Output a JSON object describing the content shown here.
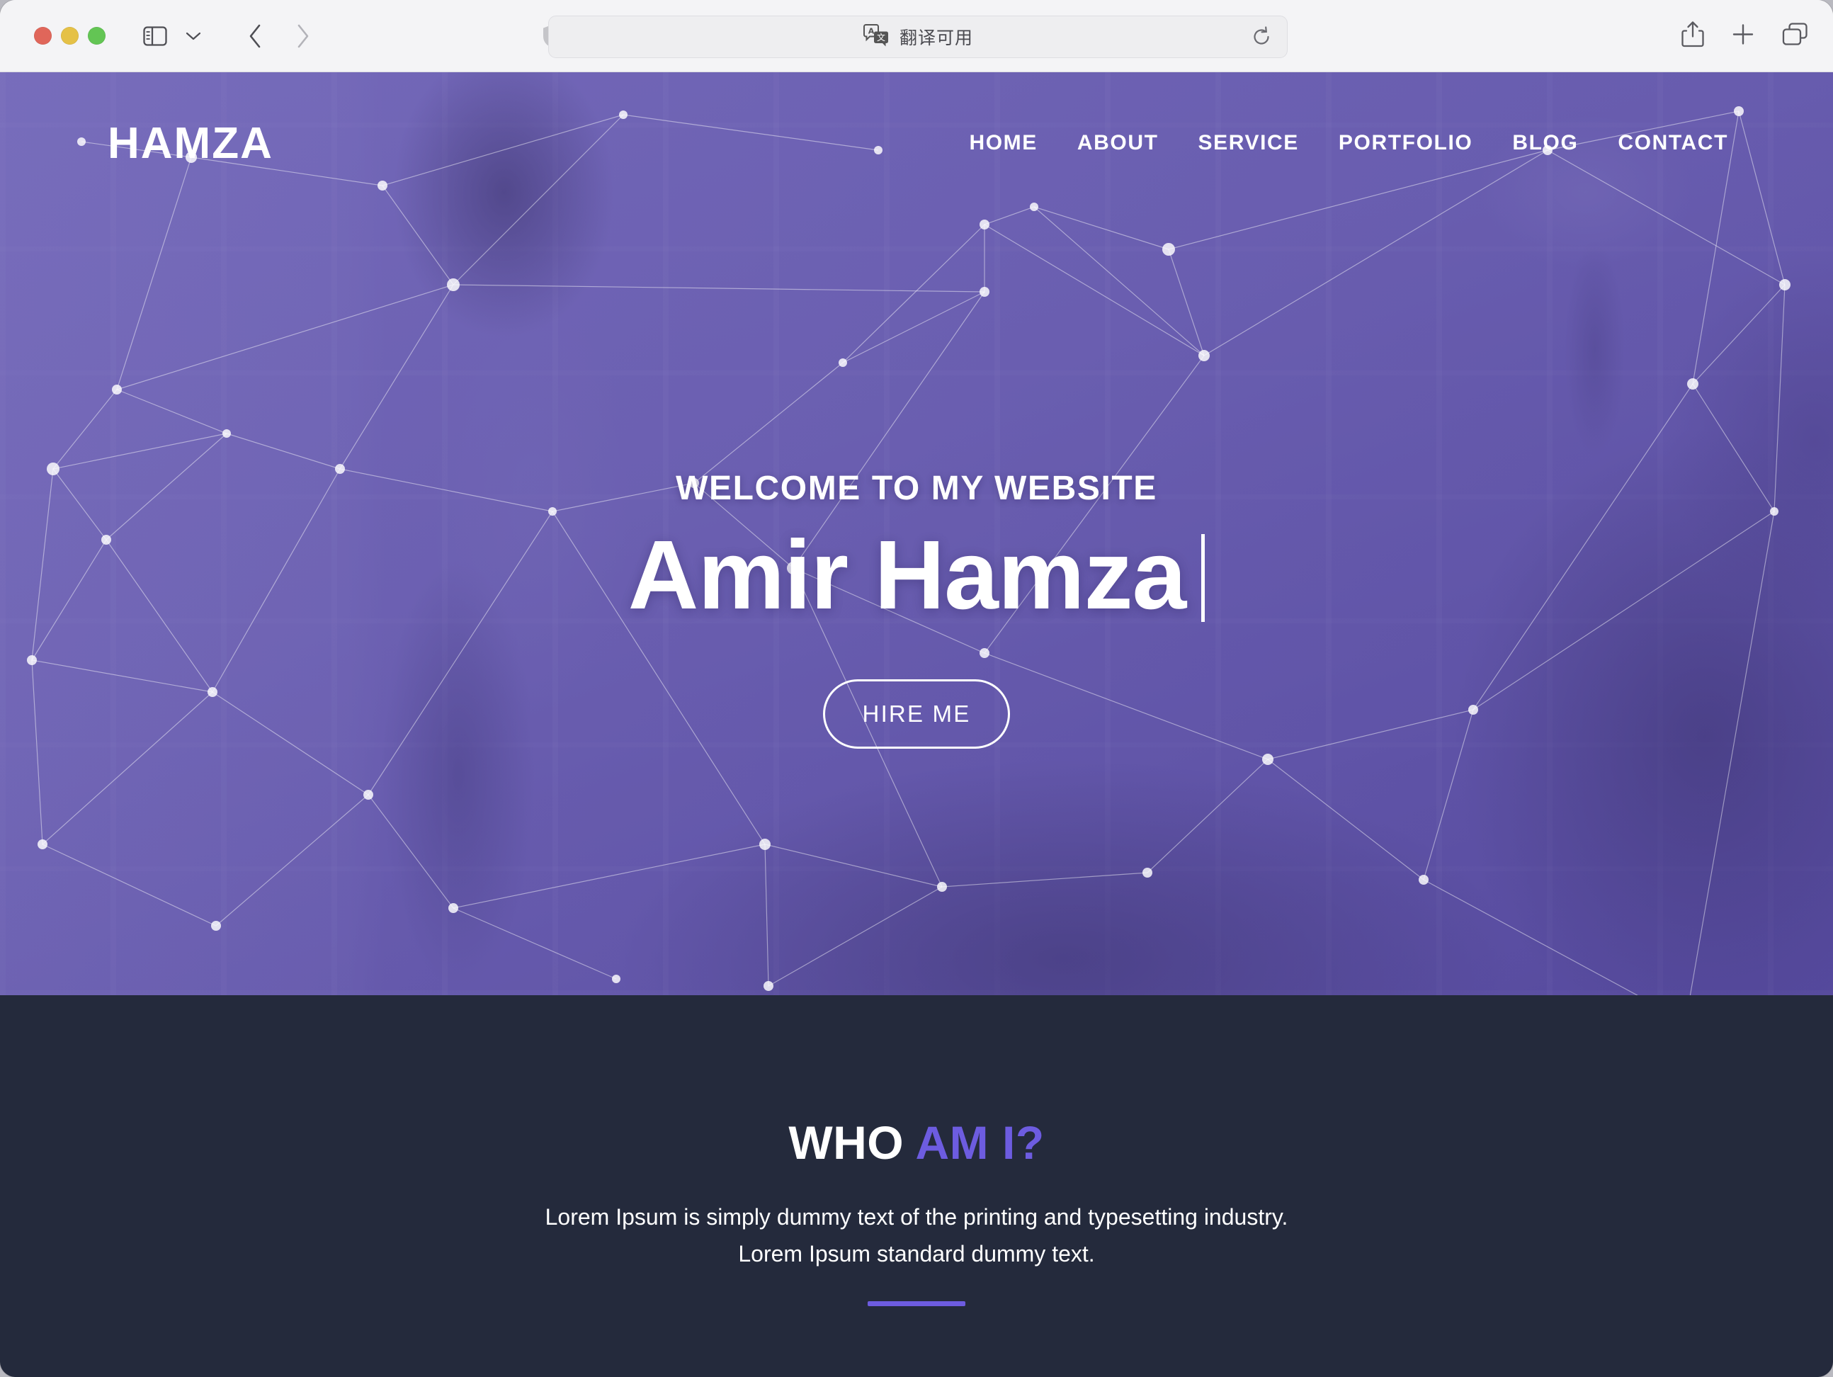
{
  "browser": {
    "window_controls": [
      "close",
      "minimize",
      "zoom"
    ],
    "sidebar_icon": "sidebar-icon",
    "chevron_icon": "chevron-down-icon",
    "back_icon": "chevron-left-icon",
    "forward_icon": "chevron-right-icon",
    "shield_icon": "shield-privacy-icon",
    "address_text": "翻译可用",
    "translate_icon": "translate-icon",
    "reload_icon": "reload-icon",
    "share_icon": "share-icon",
    "new_tab_icon": "plus-icon",
    "tab_overview_icon": "tab-overview-icon"
  },
  "site": {
    "logo": "HAMZA",
    "nav": [
      {
        "label": "HOME"
      },
      {
        "label": "ABOUT"
      },
      {
        "label": "SERVICE"
      },
      {
        "label": "PORTFOLIO"
      },
      {
        "label": "BLOG"
      },
      {
        "label": "CONTACT"
      }
    ],
    "hero": {
      "welcome": "WELCOME TO MY WEBSITE",
      "name": "Amir Hamza",
      "cta_label": "HIRE ME"
    },
    "about": {
      "title_main": "WHO ",
      "title_accent": "AM I?",
      "paragraph": "Lorem Ipsum is simply dummy text of the printing and typesetting industry. Lorem Ipsum standard dummy text."
    },
    "colors": {
      "hero_overlay": "#6a5fab",
      "dark_section": "#242a3c",
      "accent_purple": "#6d5ce0",
      "white": "#ffffff",
      "toolbar_bg": "#f4f4f6"
    }
  }
}
